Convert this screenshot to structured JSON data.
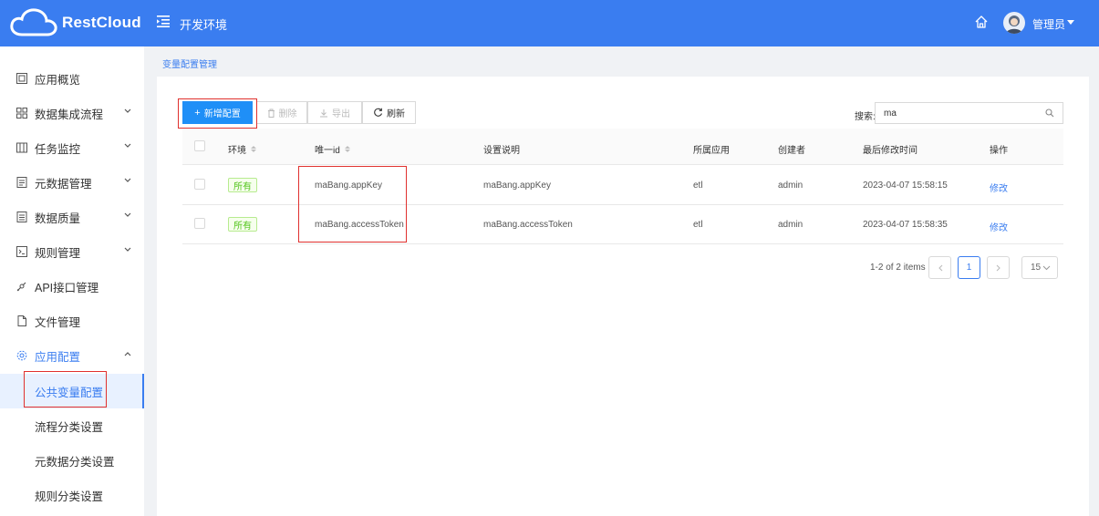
{
  "header": {
    "brand": "RestCloud",
    "env_title": "开发环境",
    "user_name": "管理员"
  },
  "sidebar": {
    "items": [
      {
        "label": "应用概览",
        "icon": "app-overview-icon",
        "expandable": false
      },
      {
        "label": "数据集成流程",
        "icon": "grid-icon",
        "expandable": true
      },
      {
        "label": "任务监控",
        "icon": "monitor-icon",
        "expandable": true
      },
      {
        "label": "元数据管理",
        "icon": "metadata-icon",
        "expandable": true
      },
      {
        "label": "数据质量",
        "icon": "quality-icon",
        "expandable": true
      },
      {
        "label": "规则管理",
        "icon": "terminal-icon",
        "expandable": true
      },
      {
        "label": "API接口管理",
        "icon": "api-icon",
        "expandable": false
      },
      {
        "label": "文件管理",
        "icon": "file-icon",
        "expandable": false
      },
      {
        "label": "应用配置",
        "icon": "settings-icon",
        "expandable": true,
        "expanded": true
      }
    ],
    "sub_items": [
      {
        "label": "公共变量配置",
        "selected": true
      },
      {
        "label": "流程分类设置",
        "selected": false
      },
      {
        "label": "元数据分类设置",
        "selected": false
      },
      {
        "label": "规则分类设置",
        "selected": false
      }
    ]
  },
  "breadcrumb": "变量配置管理",
  "toolbar": {
    "add_label": "新增配置",
    "delete_label": "删除",
    "export_label": "导出",
    "refresh_label": "刷新"
  },
  "search": {
    "label": "搜索:",
    "value": "ma"
  },
  "table": {
    "columns": [
      "环境",
      "唯一id",
      "设置说明",
      "所属应用",
      "创建者",
      "最后修改时间",
      "操作"
    ],
    "rows": [
      {
        "env": "所有",
        "id": "maBang.appKey",
        "desc": "maBang.appKey",
        "app": "etl",
        "creator": "admin",
        "modified": "2023-04-07 15:58:15",
        "action": "修改"
      },
      {
        "env": "所有",
        "id": "maBang.accessToken",
        "desc": "maBang.accessToken",
        "app": "etl",
        "creator": "admin",
        "modified": "2023-04-07 15:58:35",
        "action": "修改"
      }
    ]
  },
  "pagination": {
    "total_text": "1-2 of 2 items",
    "current_page": "1",
    "page_size": "15"
  },
  "colors": {
    "header_bg": "#3a7df0",
    "primary_button": "#1f8ff7",
    "highlight_box": "#e0312e",
    "tag_green": "#52c41a"
  }
}
